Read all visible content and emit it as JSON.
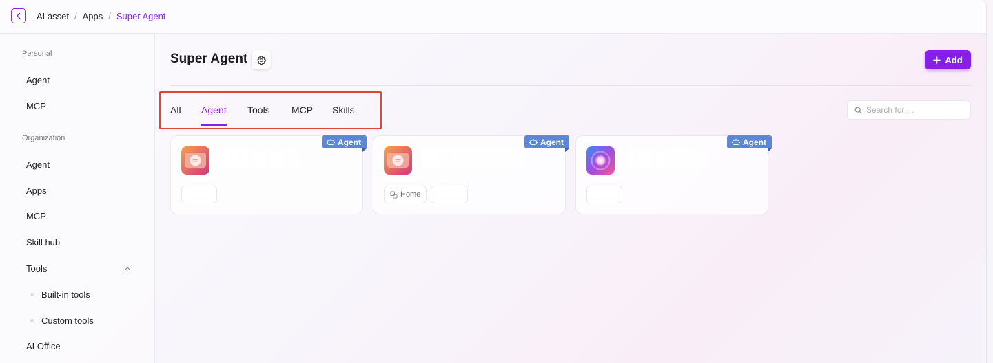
{
  "breadcrumb": {
    "items": [
      "AI asset",
      "Apps"
    ],
    "current": "Super Agent",
    "separator": "/"
  },
  "sidebar": {
    "personal_title": "Personal",
    "personal_items": [
      "Agent",
      "MCP"
    ],
    "organization_title": "Organization",
    "organization_items": [
      "Agent",
      "Apps",
      "MCP",
      "Skill hub",
      "Tools"
    ],
    "tools_children": [
      "Built-in tools",
      "Custom tools"
    ],
    "after_tools": "AI Office"
  },
  "main": {
    "title": "Super Agent",
    "add_label": "Add",
    "tabs": [
      "All",
      "Agent",
      "Tools",
      "MCP",
      "Skills"
    ],
    "active_tab": "Agent",
    "search_placeholder": "Search for ..."
  },
  "cards": [
    {
      "badge": "Agent",
      "tags": [
        ""
      ]
    },
    {
      "badge": "Agent",
      "tags": [
        "Home",
        ""
      ]
    },
    {
      "badge": "Agent",
      "tags": [
        ""
      ]
    }
  ],
  "colors": {
    "accent": "#8620e6",
    "badge": "#5b87d6",
    "highlight_frame": "#e0453a"
  }
}
